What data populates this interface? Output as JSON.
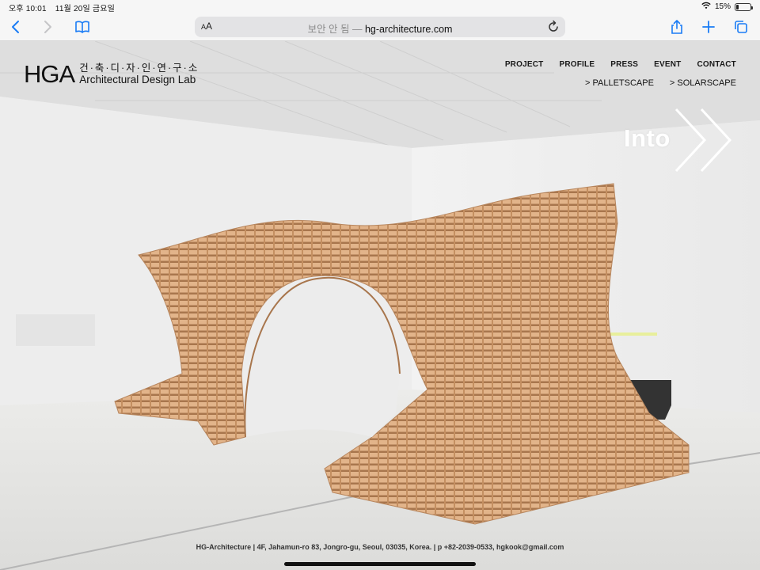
{
  "status_bar": {
    "time": "오후 10:01",
    "date": "11월 20일 금요일",
    "battery": "15%",
    "battery_level": 0.15
  },
  "browser": {
    "text_size_label": "AA",
    "url_prefix": "보안 안 됨 —",
    "url": "hg-architecture.com"
  },
  "site": {
    "logo_mark": "HGA",
    "logo_korean": "건·축·디·자·인·연·구·소",
    "logo_english": "Architectural Design Lab",
    "nav": [
      "PROJECT",
      "PROFILE",
      "PRESS",
      "EVENT",
      "CONTACT"
    ],
    "subnav": [
      "> PALLETSCAPE",
      "> SOLARSCAPE"
    ],
    "into_label": "Into",
    "footer": "HG-Architecture | 4F, Jahamun-ro 83, Jongro-gu, Seoul, 03035, Korea. | p +82-2039-0533, hgkook@gmail.com"
  },
  "colors": {
    "accent": "#1a7cf5",
    "wood": "#d9a67a",
    "wall": "#eeeeee"
  }
}
